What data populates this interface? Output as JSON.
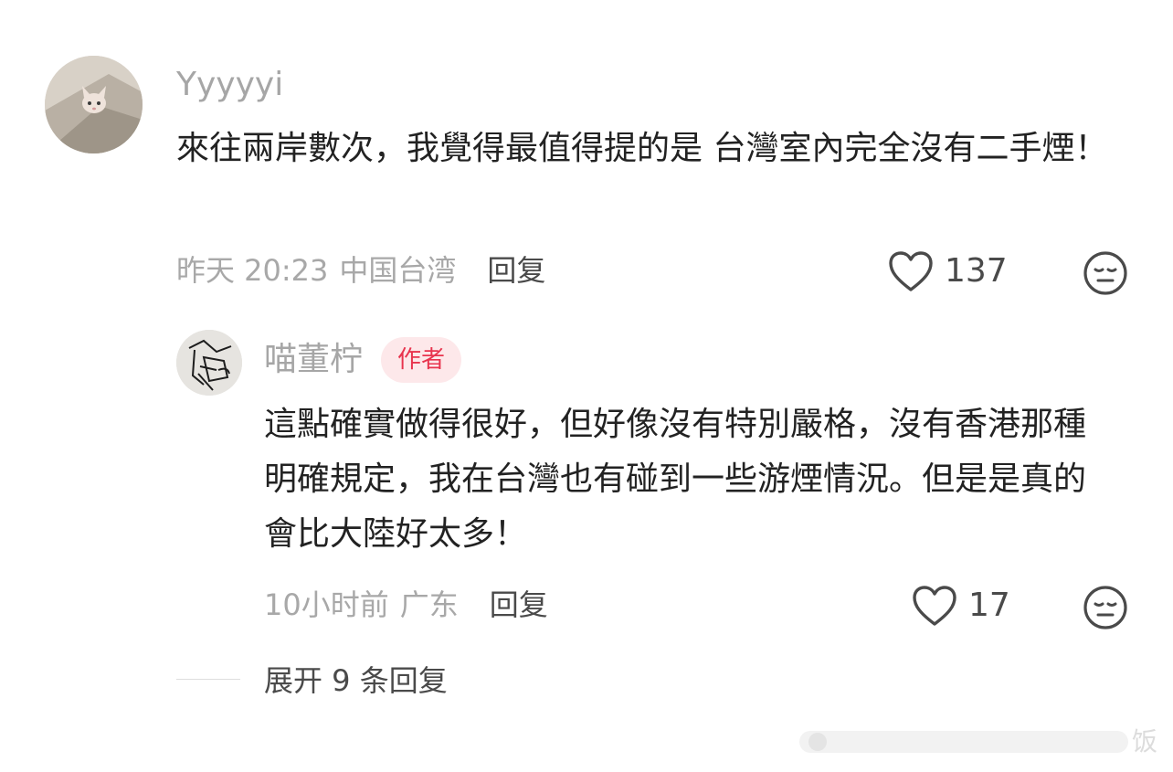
{
  "comments": [
    {
      "username": "Yyyyyi",
      "text": "來往兩岸數次，我覺得最值得提的是 台灣室內完全沒有二手煙！",
      "time": "昨天 20:23",
      "location": "中国台湾",
      "reply_label": "回复",
      "likes": "137"
    }
  ],
  "replies": [
    {
      "username": "喵董柠",
      "badge": "作者",
      "text": "這點確實做得很好，但好像沒有特別嚴格，沒有香港那種明確規定，我在台灣也有碰到一些游煙情況。但是是真的會比大陸好太多！",
      "time": "10小时前",
      "location": "广东",
      "reply_label": "回复",
      "likes": "17"
    }
  ],
  "expand_label": "展开 9 条回复",
  "watermark": "饭",
  "icons": {
    "like": "heart-outline-icon",
    "dislike": "meh-face-icon"
  },
  "colors": {
    "badge_bg": "#fde8ea",
    "badge_text": "#e8344e",
    "muted_text": "#a8a8a8",
    "icon": "#4a4a4a"
  }
}
